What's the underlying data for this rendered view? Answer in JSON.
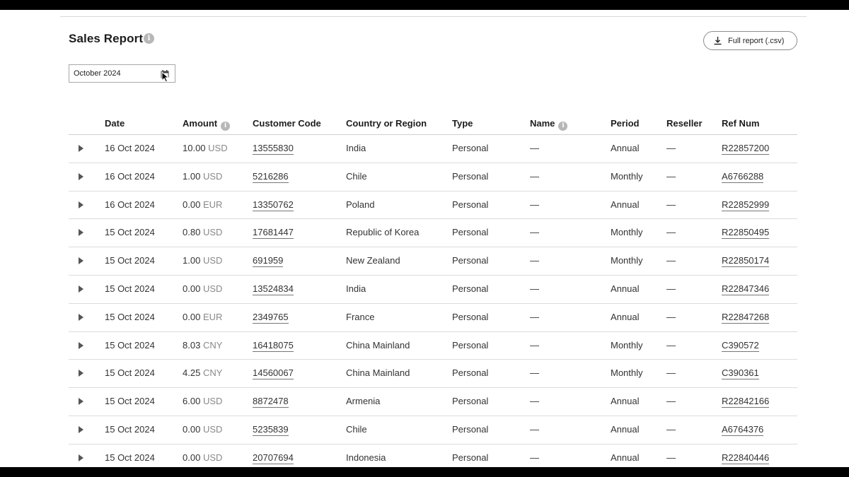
{
  "report": {
    "title": "Sales Report",
    "info_glyph": "i",
    "download_label": "Full report (.csv)",
    "month_value": "October 2024"
  },
  "icons": {
    "info": "info-icon",
    "download": "download-icon",
    "calendar": "calendar-icon",
    "expand": "expand-caret-icon"
  },
  "colors": {
    "text": "#1d1d1f",
    "muted": "#888888",
    "border": "#dcdcdc",
    "info_icon": "#b7b7b7"
  },
  "table": {
    "columns": {
      "date": "Date",
      "amount": "Amount",
      "customer_code": "Customer Code",
      "country": "Country or Region",
      "type": "Type",
      "name": "Name",
      "period": "Period",
      "reseller": "Reseller",
      "ref_num": "Ref Num"
    },
    "rows": [
      {
        "date": "16 Oct 2024",
        "amount": "10.00",
        "currency": "USD",
        "customer_code": "13555830",
        "country": "India",
        "type": "Personal",
        "name": "—",
        "period": "Annual",
        "reseller": "—",
        "ref_num": "R22857200"
      },
      {
        "date": "16 Oct 2024",
        "amount": "1.00",
        "currency": "USD",
        "customer_code": "5216286",
        "country": "Chile",
        "type": "Personal",
        "name": "—",
        "period": "Monthly",
        "reseller": "—",
        "ref_num": "A6766288"
      },
      {
        "date": "16 Oct 2024",
        "amount": "0.00",
        "currency": "EUR",
        "customer_code": "13350762",
        "country": "Poland",
        "type": "Personal",
        "name": "—",
        "period": "Annual",
        "reseller": "—",
        "ref_num": "R22852999"
      },
      {
        "date": "15 Oct 2024",
        "amount": "0.80",
        "currency": "USD",
        "customer_code": "17681447",
        "country": "Republic of Korea",
        "type": "Personal",
        "name": "—",
        "period": "Monthly",
        "reseller": "—",
        "ref_num": "R22850495"
      },
      {
        "date": "15 Oct 2024",
        "amount": "1.00",
        "currency": "USD",
        "customer_code": "691959",
        "country": "New Zealand",
        "type": "Personal",
        "name": "—",
        "period": "Monthly",
        "reseller": "—",
        "ref_num": "R22850174"
      },
      {
        "date": "15 Oct 2024",
        "amount": "0.00",
        "currency": "USD",
        "customer_code": "13524834",
        "country": "India",
        "type": "Personal",
        "name": "—",
        "period": "Annual",
        "reseller": "—",
        "ref_num": "R22847346"
      },
      {
        "date": "15 Oct 2024",
        "amount": "0.00",
        "currency": "EUR",
        "customer_code": "2349765",
        "country": "France",
        "type": "Personal",
        "name": "—",
        "period": "Annual",
        "reseller": "—",
        "ref_num": "R22847268"
      },
      {
        "date": "15 Oct 2024",
        "amount": "8.03",
        "currency": "CNY",
        "customer_code": "16418075",
        "country": "China Mainland",
        "type": "Personal",
        "name": "—",
        "period": "Monthly",
        "reseller": "—",
        "ref_num": "C390572"
      },
      {
        "date": "15 Oct 2024",
        "amount": "4.25",
        "currency": "CNY",
        "customer_code": "14560067",
        "country": "China Mainland",
        "type": "Personal",
        "name": "—",
        "period": "Monthly",
        "reseller": "—",
        "ref_num": "C390361"
      },
      {
        "date": "15 Oct 2024",
        "amount": "6.00",
        "currency": "USD",
        "customer_code": "8872478",
        "country": "Armenia",
        "type": "Personal",
        "name": "—",
        "period": "Annual",
        "reseller": "—",
        "ref_num": "R22842166"
      },
      {
        "date": "15 Oct 2024",
        "amount": "0.00",
        "currency": "USD",
        "customer_code": "5235839",
        "country": "Chile",
        "type": "Personal",
        "name": "—",
        "period": "Annual",
        "reseller": "—",
        "ref_num": "A6764376"
      },
      {
        "date": "15 Oct 2024",
        "amount": "0.00",
        "currency": "USD",
        "customer_code": "20707694",
        "country": "Indonesia",
        "type": "Personal",
        "name": "—",
        "period": "Annual",
        "reseller": "—",
        "ref_num": "R22840446"
      }
    ]
  }
}
